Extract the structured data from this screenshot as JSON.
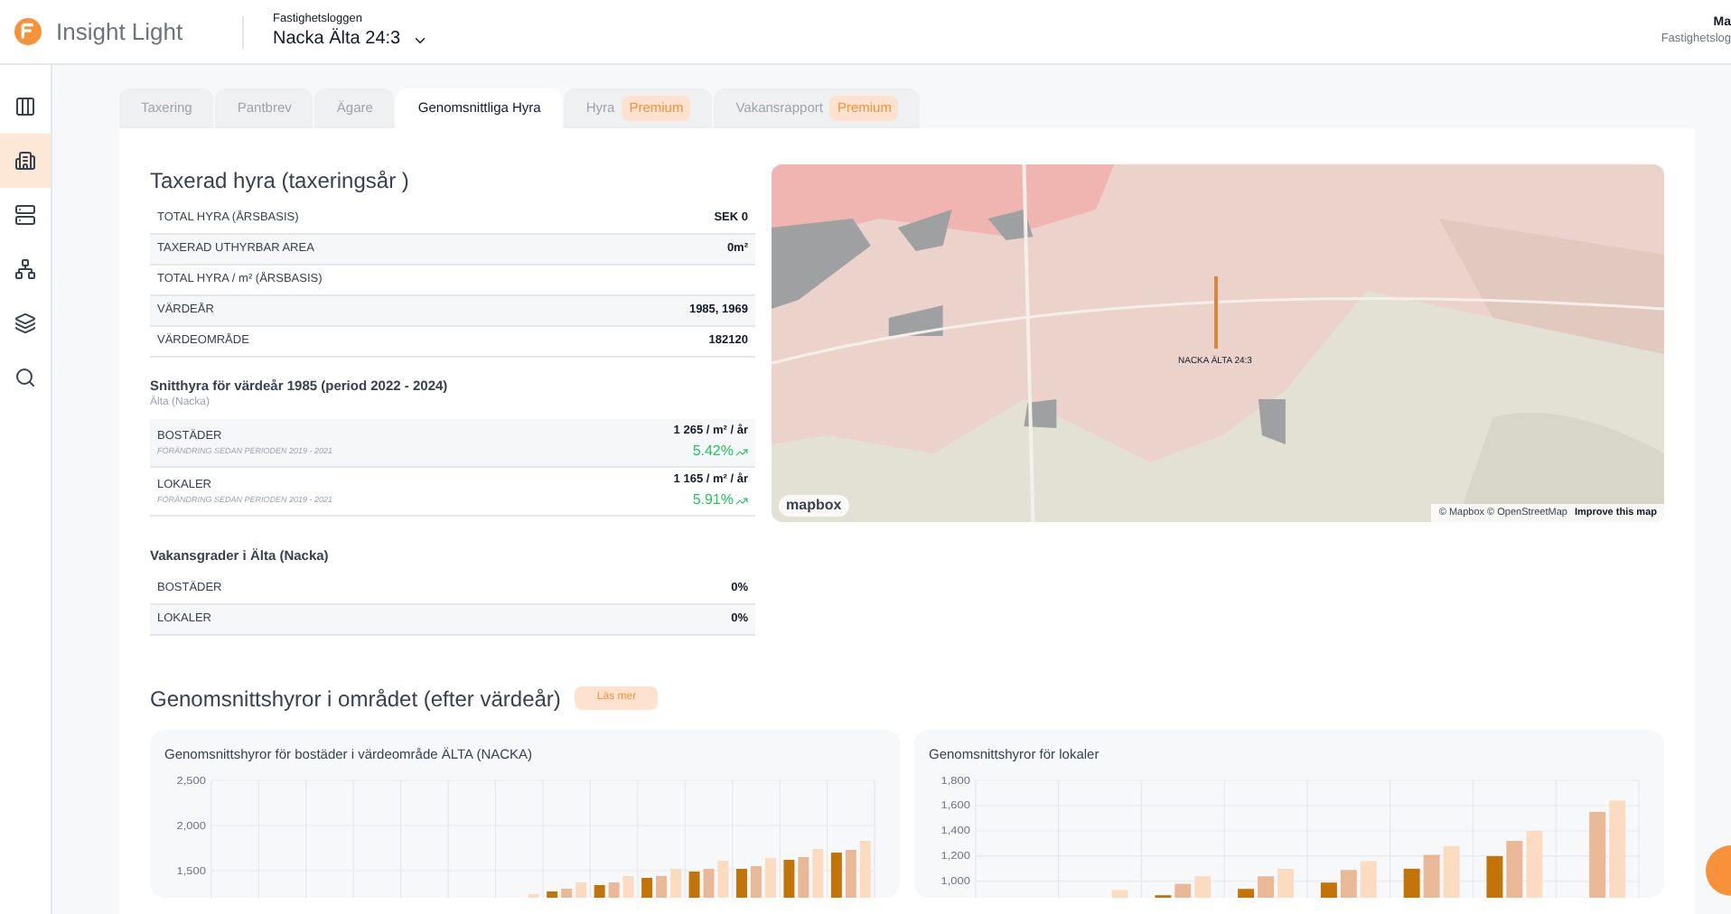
{
  "header": {
    "app_name": "Insight Light",
    "context_label": "Fastighetsloggen",
    "property": "Nacka Älta 24:3",
    "user_name": "Ma",
    "user_org": "Fastighetslog"
  },
  "sidebar": {
    "items": [
      {
        "selected": false
      },
      {
        "selected": true
      },
      {
        "selected": false
      },
      {
        "selected": false
      },
      {
        "selected": false
      },
      {
        "selected": false
      }
    ]
  },
  "tabs": [
    {
      "label": "Taxering",
      "selected": false
    },
    {
      "label": "Pantbrev",
      "selected": false
    },
    {
      "label": "Ägare",
      "selected": false
    },
    {
      "label": "Genomsnittliga Hyra",
      "selected": true
    },
    {
      "label": "Hyra",
      "selected": false,
      "badge": "Premium"
    },
    {
      "label": "Vakansrapport",
      "selected": false,
      "badge": "Premium"
    }
  ],
  "taxed_rent": {
    "title": "Taxerad hyra (taxeringsår )",
    "rows": [
      {
        "label": "TOTAL HYRA (ÅRSBASIS)",
        "value": "SEK 0"
      },
      {
        "label": "TAXERAD UTHYRBAR AREA",
        "value": "0m²"
      },
      {
        "label": "TOTAL HYRA / m² (ÅRSBASIS)"
      },
      {
        "label": "VÄRDEÅR",
        "value": "1985, 1969"
      },
      {
        "label": "VÄRDEOMRÅDE",
        "value": "182120"
      }
    ]
  },
  "average_rent": {
    "title": "Snitthyra för värdeår 1985 (period 2022 - 2024)",
    "subtitle": "Älta (Nacka)",
    "rows": [
      {
        "label": "BOSTÄDER",
        "note": "FÖRÄNDRING SEDAN PERIODEN 2019 - 2021",
        "value": "1 265 / m² / år",
        "change": "5.42%"
      },
      {
        "label": "LOKALER",
        "note": "FÖRÄNDRING SEDAN PERIODEN 2019 - 2021",
        "value": "1 165 / m² / år",
        "change": "5.91%"
      }
    ]
  },
  "vacancy": {
    "title": "Vakansgrader i Älta (Nacka)",
    "rows": [
      {
        "label": "BOSTÄDER",
        "value": "0%"
      },
      {
        "label": "LOKALER",
        "value": "0%"
      }
    ]
  },
  "map": {
    "marker_label": "NACKA ÄLTA 24:3",
    "logo": "mapbox",
    "attribution": "© Mapbox © OpenStreetMap",
    "improve_link": "Improve this map"
  },
  "charts_section": {
    "title": "Genomsnittshyror i området (efter värdeår)",
    "read_more": "Läs mer",
    "charts": [
      {
        "chart_data": {
          "type": "bar",
          "grid": true,
          "title": "Genomsnittshyror för bostäder i värdeområde ÄLTA (NACKA)",
          "ylim": [
            1200,
            2500
          ],
          "yticks": [
            {
              "value": 1500,
              "label": "1,500"
            },
            {
              "value": 2000,
              "label": "2,000"
            },
            {
              "value": 2500,
              "label": "2,500"
            }
          ],
          "series": [
            {
              "color": "#c27408",
              "values": [
                null,
                null,
                null,
                null,
                null,
                null,
                null,
                1270,
                1340,
                1420,
                1490,
                1520,
                1620,
                1700
              ]
            },
            {
              "color": "#e9b896",
              "values": [
                null,
                null,
                null,
                null,
                null,
                null,
                null,
                1300,
                1370,
                1440,
                1520,
                1550,
                1650,
                1730
              ]
            },
            {
              "color": "#fcdcc0",
              "values": [
                null,
                null,
                null,
                null,
                null,
                null,
                1240,
                1370,
                1440,
                1520,
                1610,
                1640,
                1740,
                1830
              ]
            }
          ]
        }
      },
      {
        "chart_data": {
          "type": "bar",
          "grid": true,
          "title": "Genomsnittshyror för lokaler",
          "ylim": [
            870,
            1800
          ],
          "yticks": [
            {
              "value": 1000,
              "label": "1,000"
            },
            {
              "value": 1200,
              "label": "1,200"
            },
            {
              "value": 1400,
              "label": "1,400"
            },
            {
              "value": 1600,
              "label": "1,600"
            },
            {
              "value": 1800,
              "label": "1,800"
            }
          ],
          "series": [
            {
              "color": "#c27408",
              "values": [
                null,
                null,
                890,
                940,
                990,
                1100,
                1200,
                null
              ]
            },
            {
              "color": "#e9b896",
              "values": [
                null,
                null,
                980,
                1040,
                1090,
                1210,
                1320,
                1550
              ]
            },
            {
              "color": "#fcdcc0",
              "values": [
                null,
                930,
                1040,
                1100,
                1160,
                1280,
                1400,
                1640
              ]
            }
          ]
        }
      }
    ]
  }
}
